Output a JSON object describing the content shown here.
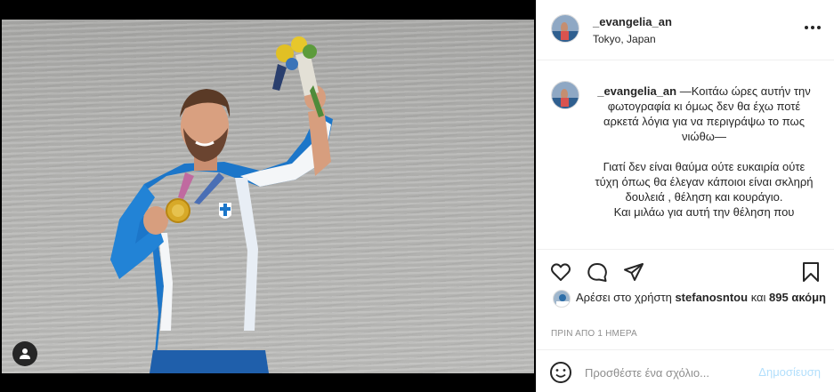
{
  "post": {
    "username": "_evangelia_an",
    "location": "Tokyo, Japan"
  },
  "caption": {
    "username": "_evangelia_an",
    "line1": " —Κοιτάω ώρες αυτήν την φωτογραφία κι όμως δεν θα έχω ποτέ αρκετά λόγια για να περιγράψω το πως νιώθω—",
    "line2": "Γιατί δεν είναι θαύμα ούτε ευκαιρία ούτε τύχη όπως θα έλεγαν κάποιοι είναι σκληρή δουλειά , θέληση και κουράγιο.",
    "line3": "Και μιλάω για αυτή την θέληση που"
  },
  "likes": {
    "prefix": "Αρέσει στο χρήστη ",
    "liker": "stefanosntou",
    "middle": " και ",
    "others": "895 ακόμη"
  },
  "timestamp": "ΠΡΙΝ ΑΠΟ 1 ΗΜΕΡΑ",
  "comment_box": {
    "placeholder": "Προσθέστε ένα σχόλιο...",
    "post_label": "Δημοσίευση"
  },
  "icons": {
    "more": "more-options-icon",
    "like": "heart-icon",
    "comment": "comment-bubble-icon",
    "share": "paper-plane-icon",
    "save": "bookmark-icon",
    "emoji": "emoji-smile-icon",
    "tag": "user-tag-icon"
  },
  "colors": {
    "primary_text": "#262626",
    "secondary_text": "#8e8e8e",
    "border": "#efefef",
    "post_button_disabled": "#b2dffc"
  }
}
